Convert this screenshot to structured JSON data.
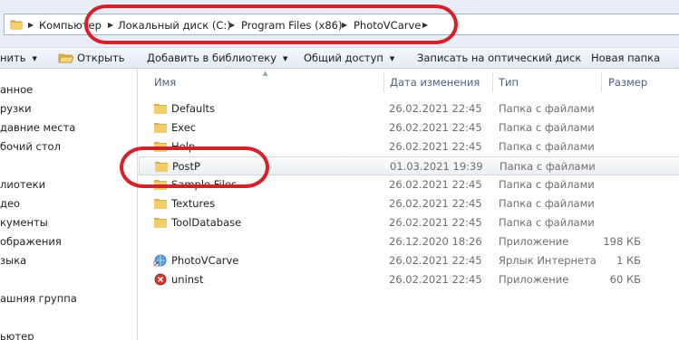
{
  "breadcrumb": {
    "items": [
      "Компьютер",
      "Локальный диск (C:)",
      "Program Files (x86)",
      "PhotoVCarve"
    ]
  },
  "toolbar": {
    "organize": "нить",
    "open": "Открыть",
    "add_library": "Добавить в библиотеку",
    "share": "Общий доступ",
    "burn": "Записать на оптический диск",
    "new_folder": "Новая папка"
  },
  "nav": {
    "items": [
      "анное",
      "рузки",
      "давние места",
      "бочий стол",
      "",
      "лиотеки",
      "део",
      "кументы",
      "ображения",
      "зыка",
      "",
      "ашняя группа",
      "",
      "ьютер"
    ]
  },
  "columns": {
    "name": "Имя",
    "date": "Дата изменения",
    "type": "Тип",
    "size": "Размер"
  },
  "files": [
    {
      "name": "Defaults",
      "date": "26.02.2021 22:45",
      "type": "Папка с файлами",
      "size": "",
      "icon": "folder-icon"
    },
    {
      "name": "Exec",
      "date": "26.02.2021 22:45",
      "type": "Папка с файлами",
      "size": "",
      "icon": "folder-icon"
    },
    {
      "name": "Help",
      "date": "26.02.2021 22:45",
      "type": "Папка с файлами",
      "size": "",
      "icon": "folder-icon"
    },
    {
      "name": "PostP",
      "date": "01.03.2021 19:39",
      "type": "Папка с файлами",
      "size": "",
      "icon": "folder-icon"
    },
    {
      "name": "Sample Files",
      "date": "26.02.2021 22:45",
      "type": "Папка с файлами",
      "size": "",
      "icon": "folder-icon"
    },
    {
      "name": "Textures",
      "date": "26.02.2021 22:45",
      "type": "Папка с файлами",
      "size": "",
      "icon": "folder-icon"
    },
    {
      "name": "ToolDatabase",
      "date": "26.02.2021 22:45",
      "type": "Папка с файлами",
      "size": "",
      "icon": "folder-icon"
    },
    {
      "name": "",
      "date": "26.12.2020 18:26",
      "type": "Приложение",
      "size": "198 КБ",
      "icon": "blank-icon"
    },
    {
      "name": "PhotoVCarve",
      "date": "26.02.2021 22:45",
      "type": "Ярлык Интернета",
      "size": "1 КБ",
      "icon": "internet-shortcut-icon"
    },
    {
      "name": "uninst",
      "date": "26.02.2021 22:45",
      "type": "Приложение",
      "size": "60 КБ",
      "icon": "uninstall-icon"
    }
  ],
  "highlight_color": "#d8202b"
}
